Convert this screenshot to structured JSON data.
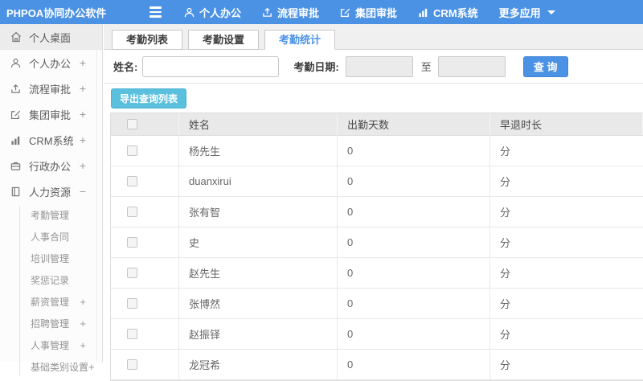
{
  "app": {
    "title": "PHPOA协同办公软件"
  },
  "topnav": {
    "items": [
      {
        "label": "个人办公",
        "icon": "user-icon"
      },
      {
        "label": "流程审批",
        "icon": "upload-icon"
      },
      {
        "label": "集团审批",
        "icon": "edit-icon"
      },
      {
        "label": "CRM系统",
        "icon": "bar-chart-icon"
      },
      {
        "label": "更多应用",
        "icon": "caret-down-icon"
      }
    ]
  },
  "sidebar": {
    "items": [
      {
        "label": "个人桌面",
        "icon": "home-icon",
        "expand": ""
      },
      {
        "label": "个人办公",
        "icon": "user-icon",
        "expand": "+"
      },
      {
        "label": "流程审批",
        "icon": "upload-icon",
        "expand": "+"
      },
      {
        "label": "集团审批",
        "icon": "edit-icon",
        "expand": "+"
      },
      {
        "label": "CRM系统",
        "icon": "bar-chart-icon",
        "expand": "+"
      },
      {
        "label": "行政办公",
        "icon": "briefcase-icon",
        "expand": "+"
      },
      {
        "label": "人力资源",
        "icon": "address-book-icon",
        "expand": "−"
      }
    ],
    "subitems": [
      {
        "label": "考勤管理",
        "expand": ""
      },
      {
        "label": "人事合同",
        "expand": ""
      },
      {
        "label": "培训管理",
        "expand": ""
      },
      {
        "label": "奖惩记录",
        "expand": ""
      },
      {
        "label": "薪资管理",
        "expand": "+"
      },
      {
        "label": "招聘管理",
        "expand": "+"
      },
      {
        "label": "人事管理",
        "expand": "+"
      },
      {
        "label": "基础类别设置",
        "expand": "+"
      }
    ]
  },
  "tabs": [
    {
      "label": "考勤列表"
    },
    {
      "label": "考勤设置"
    },
    {
      "label": "考勤统计"
    }
  ],
  "filter": {
    "name_label": "姓名:",
    "name_value": "",
    "date_label": "考勤日期:",
    "date_from_value": "",
    "to_label": "至",
    "date_to_value": "",
    "search_button": "查 询"
  },
  "toolbar": {
    "export_button": "导出查询列表"
  },
  "table": {
    "headers": {
      "name": "姓名",
      "days": "出勤天数",
      "duration": "早退时长"
    },
    "rows": [
      {
        "name": "杨先生",
        "days": "0",
        "duration": "分"
      },
      {
        "name": "duanxirui",
        "days": "0",
        "duration": "分"
      },
      {
        "name": "张有智",
        "days": "0",
        "duration": "分"
      },
      {
        "name": "史",
        "days": "0",
        "duration": "分"
      },
      {
        "name": "赵先生",
        "days": "0",
        "duration": "分"
      },
      {
        "name": "张博然",
        "days": "0",
        "duration": "分"
      },
      {
        "name": "赵振铎",
        "days": "0",
        "duration": "分"
      },
      {
        "name": "龙冠希",
        "days": "0",
        "duration": "分"
      }
    ]
  },
  "colors": {
    "topbar_blue": "#4b92e4",
    "accent_blue": "#4b92e4",
    "export_info_blue": "#5bc0de",
    "tabbar_gray": "#f0f0f0",
    "table_header_gray": "#e9e9e9"
  }
}
